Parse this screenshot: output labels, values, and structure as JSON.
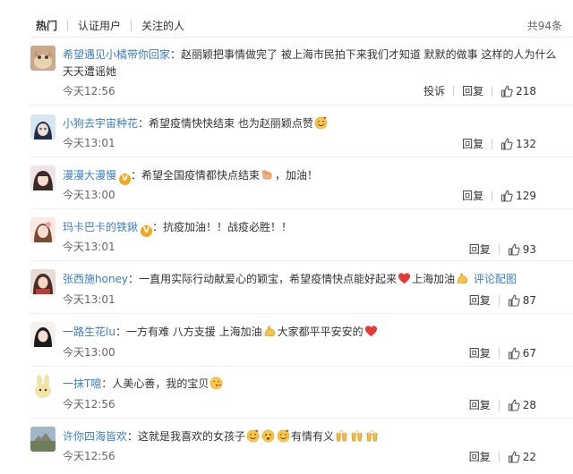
{
  "tabs": [
    {
      "label": "热门",
      "active": true
    },
    {
      "label": "认证用户",
      "active": false
    },
    {
      "label": "关注的人",
      "active": false
    }
  ],
  "total_count": "共94条",
  "labels": {
    "report": "投诉",
    "reply": "回复",
    "sep": "：",
    "view_image": "评论配图"
  },
  "comments": [
    {
      "name": "希望遇见小橘带你回家",
      "verified": false,
      "text": "赵丽颖把事情做完了 被上海市民拍下来我们才知道 默默的做事 这样的人为什么天天遭谣她",
      "time": "今天12:56",
      "likes": "218",
      "show_report": true
    },
    {
      "name": "小狗去宇宙种花",
      "verified": false,
      "text": "希望疫情快快结束 也为赵丽颖点赞",
      "time": "今天13:01",
      "likes": "132",
      "show_report": false
    },
    {
      "name": "漫漫大漫慢",
      "verified": true,
      "text_before": "希望全国疫情都快点结束",
      "text_after": "，加油！",
      "time": "今天13:00",
      "likes": "129",
      "show_report": false
    },
    {
      "name": "玛卡巴卡的铁鍬",
      "verified": true,
      "text": "抗疫加油！！战疫必胜！！",
      "time": "今天13:01",
      "likes": "93",
      "show_report": false
    },
    {
      "name": "张西施honey",
      "verified": false,
      "text_before": "一直用实际行动献爱心的颖宝，希望疫情快点能好起来",
      "text_after": "上海加油",
      "time": "今天13:01",
      "likes": "87",
      "show_report": false
    },
    {
      "name": "一路生花lu",
      "verified": false,
      "text_before": "一方有难 八方支援 上海加油",
      "text_after": "大家都平平安安的",
      "time": "今天13:00",
      "likes": "67",
      "show_report": false
    },
    {
      "name": "一抹T噫",
      "verified": false,
      "text": "人美心善，我的宝贝",
      "time": "今天12:56",
      "likes": "28",
      "show_report": false
    },
    {
      "name": "许你四海皆欢",
      "verified": false,
      "text_before": "这就是我喜欢的女孩子",
      "text_after": "有情有义",
      "time": "今天12:56",
      "likes": "22",
      "show_report": false
    }
  ],
  "colors": {
    "link": "#3b7fc4",
    "badge": "#f5a623",
    "text": "#333333",
    "meta": "#666666"
  }
}
